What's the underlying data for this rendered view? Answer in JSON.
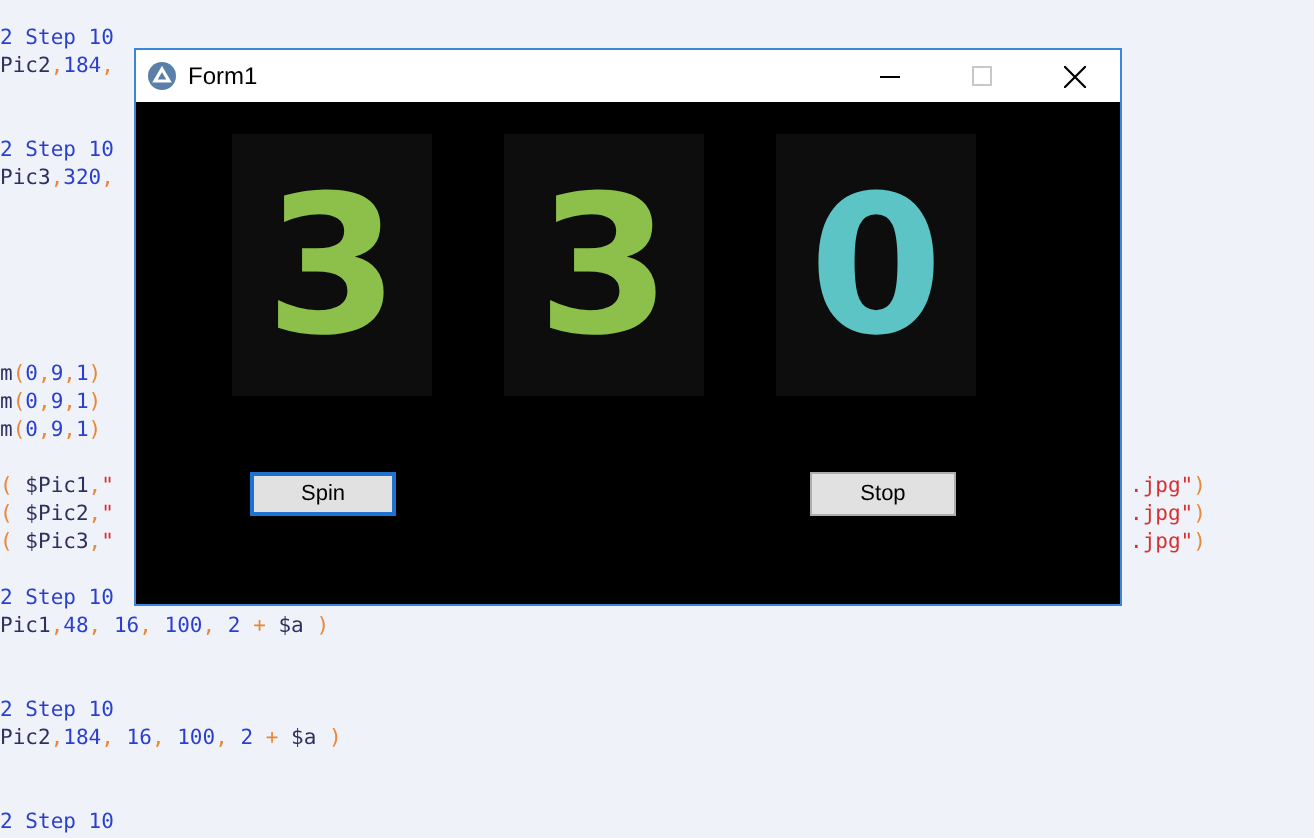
{
  "editor": {
    "lines": [
      {
        "segments": [
          {
            "kind": "number",
            "text": "2"
          },
          {
            "kind": "keyword",
            "text": " Step "
          },
          {
            "kind": "number",
            "text": "10"
          }
        ]
      },
      {
        "segments": [
          {
            "kind": "plain",
            "text": "Pic2,"
          },
          {
            "kind": "number",
            "text": "184,"
          }
        ]
      },
      {
        "segments": [
          {
            "kind": "number",
            "text": "2"
          },
          {
            "kind": "keyword",
            "text": " Step "
          },
          {
            "kind": "number",
            "text": "10"
          }
        ]
      },
      {
        "segments": [
          {
            "kind": "plain",
            "text": "Pic3,"
          },
          {
            "kind": "number",
            "text": "320,"
          }
        ]
      },
      {
        "segments": [
          {
            "kind": "plain",
            "text": "m"
          },
          {
            "kind": "punct",
            "text": "("
          },
          {
            "kind": "number",
            "text": "0"
          },
          {
            "kind": "punct",
            "text": ","
          },
          {
            "kind": "number",
            "text": "9"
          },
          {
            "kind": "punct",
            "text": ","
          },
          {
            "kind": "number",
            "text": "1"
          },
          {
            "kind": "punct",
            "text": ")"
          }
        ]
      },
      {
        "segments": [
          {
            "kind": "plain",
            "text": "m"
          },
          {
            "kind": "punct",
            "text": "("
          },
          {
            "kind": "number",
            "text": "0"
          },
          {
            "kind": "punct",
            "text": ","
          },
          {
            "kind": "number",
            "text": "9"
          },
          {
            "kind": "punct",
            "text": ","
          },
          {
            "kind": "number",
            "text": "1"
          },
          {
            "kind": "punct",
            "text": ")"
          }
        ]
      },
      {
        "segments": [
          {
            "kind": "plain",
            "text": "m"
          },
          {
            "kind": "punct",
            "text": "("
          },
          {
            "kind": "number",
            "text": "0"
          },
          {
            "kind": "punct",
            "text": ","
          },
          {
            "kind": "number",
            "text": "9"
          },
          {
            "kind": "punct",
            "text": ","
          },
          {
            "kind": "number",
            "text": "1"
          },
          {
            "kind": "punct",
            "text": ")"
          }
        ]
      },
      {
        "segments": [
          {
            "kind": "punct",
            "text": "( "
          },
          {
            "kind": "plain",
            "text": "$Pic1,"
          },
          {
            "kind": "string",
            "text": "\""
          }
        ],
        "tail": [
          {
            "kind": "string",
            "text": ".jpg\""
          },
          {
            "kind": "punct",
            "text": ")"
          }
        ]
      },
      {
        "segments": [
          {
            "kind": "punct",
            "text": "( "
          },
          {
            "kind": "plain",
            "text": "$Pic2,"
          },
          {
            "kind": "string",
            "text": "\""
          }
        ],
        "tail": [
          {
            "kind": "string",
            "text": ".jpg\""
          },
          {
            "kind": "punct",
            "text": ")"
          }
        ]
      },
      {
        "segments": [
          {
            "kind": "punct",
            "text": "( "
          },
          {
            "kind": "plain",
            "text": "$Pic3,"
          },
          {
            "kind": "string",
            "text": "\""
          }
        ],
        "tail": [
          {
            "kind": "string",
            "text": ".jpg\""
          },
          {
            "kind": "punct",
            "text": ")"
          }
        ]
      },
      {
        "segments": [
          {
            "kind": "number",
            "text": "2"
          },
          {
            "kind": "keyword",
            "text": " Step "
          },
          {
            "kind": "number",
            "text": "10"
          }
        ]
      },
      {
        "segments": [
          {
            "kind": "plain",
            "text": "Pic1"
          },
          {
            "kind": "punct",
            "text": ","
          },
          {
            "kind": "number",
            "text": "48"
          },
          {
            "kind": "punct",
            "text": ", "
          },
          {
            "kind": "number",
            "text": "16"
          },
          {
            "kind": "punct",
            "text": ", "
          },
          {
            "kind": "number",
            "text": "100"
          },
          {
            "kind": "punct",
            "text": ", "
          },
          {
            "kind": "number",
            "text": "2"
          },
          {
            "kind": "punct",
            "text": " + "
          },
          {
            "kind": "plain",
            "text": "$a"
          },
          {
            "kind": "punct",
            "text": " )"
          }
        ]
      },
      {
        "segments": [
          {
            "kind": "number",
            "text": "2"
          },
          {
            "kind": "keyword",
            "text": " Step "
          },
          {
            "kind": "number",
            "text": "10"
          }
        ]
      },
      {
        "segments": [
          {
            "kind": "plain",
            "text": "Pic2"
          },
          {
            "kind": "punct",
            "text": ","
          },
          {
            "kind": "number",
            "text": "184"
          },
          {
            "kind": "punct",
            "text": ", "
          },
          {
            "kind": "number",
            "text": "16"
          },
          {
            "kind": "punct",
            "text": ", "
          },
          {
            "kind": "number",
            "text": "100"
          },
          {
            "kind": "punct",
            "text": ", "
          },
          {
            "kind": "number",
            "text": "2"
          },
          {
            "kind": "punct",
            "text": " + "
          },
          {
            "kind": "plain",
            "text": "$a"
          },
          {
            "kind": "punct",
            "text": " )"
          }
        ]
      },
      {
        "segments": [
          {
            "kind": "number",
            "text": "2"
          },
          {
            "kind": "keyword",
            "text": " Step "
          },
          {
            "kind": "number",
            "text": "10"
          }
        ]
      }
    ]
  },
  "window": {
    "title": "Form1",
    "maximize_disabled": true,
    "reels": [
      {
        "symbol": "3",
        "color": "#8cc04a"
      },
      {
        "symbol": "3",
        "color": "#8cc04a"
      },
      {
        "symbol": "0",
        "color": "#5cc4c4"
      }
    ],
    "buttons": [
      {
        "label": "Spin",
        "focused": true
      },
      {
        "label": "Stop",
        "focused": false
      }
    ]
  }
}
